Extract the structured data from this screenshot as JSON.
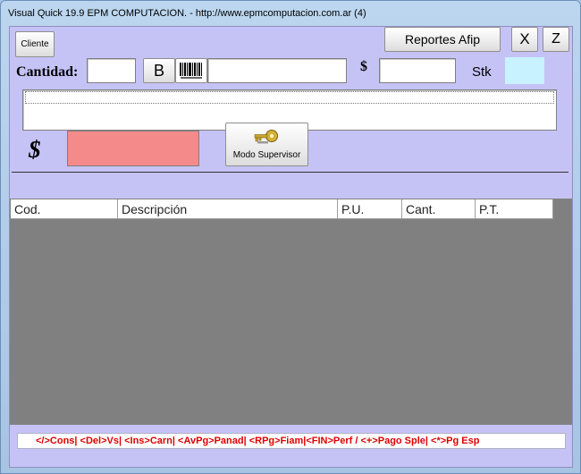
{
  "window": {
    "title": "Visual Quick 19.9 EPM COMPUTACION. - http://www.epmcomputacion.com.ar (4)"
  },
  "toolbar": {
    "cliente_label": "Cliente",
    "reportes_label": "Reportes Afip",
    "close_label": "X",
    "z_label": "Z",
    "b_label": "B",
    "modo_supervisor_label": "Modo Supervisor"
  },
  "form": {
    "cantidad_label": "Cantidad:",
    "cantidad_value": "",
    "barcode_value": "",
    "dollar_label": "$",
    "precio_value": "",
    "stk_label": "Stk",
    "stk_value": "",
    "description_value": "",
    "total_symbol": "$",
    "total_value": ""
  },
  "grid": {
    "columns": [
      "Cod.",
      "Descripción",
      "P.U.",
      "Cant.",
      "P.T."
    ]
  },
  "shortcuts": {
    "text": "</>Cons| <Del>Vs| <Ins>Carn| <AvPg>Panad| <RPg>Fiam|<FIN>Perf / <+>Pago Sple|  <*>Pg Esp"
  },
  "colors": {
    "client_bg": "#c5c3f5",
    "stk_field": "#c8f2ff",
    "total_field": "#f58a8a",
    "grid_bg": "#808080",
    "shortcut_text": "#e00000"
  },
  "icons": {
    "barcode": "barcode-icon",
    "supervisor": "key-icon"
  }
}
